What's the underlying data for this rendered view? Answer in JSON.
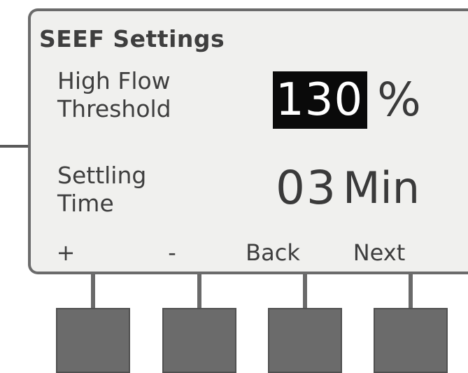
{
  "screen": {
    "title": "SEEF Settings",
    "high_flow": {
      "label_line1": "High Flow",
      "label_line2": "Threshold",
      "value": "130",
      "unit": "%",
      "selected": true
    },
    "settling_time": {
      "label_line1": "Settling",
      "label_line2": "Time",
      "value": "03",
      "unit": "Min"
    }
  },
  "softkeys": [
    {
      "label": "+"
    },
    {
      "label": "-"
    },
    {
      "label": "Back"
    },
    {
      "label": "Next"
    }
  ],
  "colors": {
    "lcd_background": "#f0f0ee",
    "lcd_text": "#3e3e3e",
    "selection_background": "#0a0a0a",
    "selection_text": "#ffffff",
    "button_fill": "#6b6b6b"
  }
}
